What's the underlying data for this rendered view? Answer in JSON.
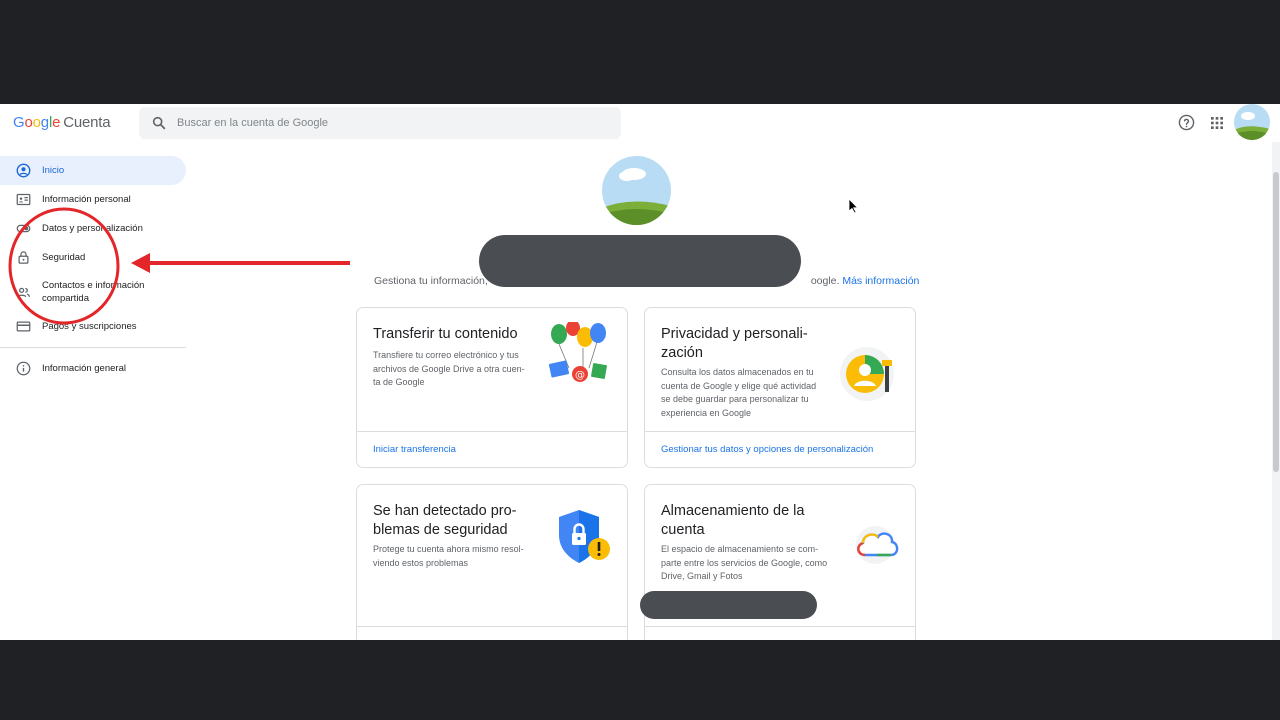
{
  "topbar": {
    "logo_google": [
      "G",
      "o",
      "o",
      "g",
      "l",
      "e"
    ],
    "logo_product": "Cuenta",
    "search_placeholder": "Buscar en la cuenta de Google"
  },
  "sidebar": {
    "items": [
      {
        "label": "Inicio",
        "active": true
      },
      {
        "label": "Información personal"
      },
      {
        "label": "Datos y personalización"
      },
      {
        "label": "Seguridad"
      },
      {
        "label": "Contactos e información compartida"
      },
      {
        "label": "Pagos y suscripciones"
      },
      {
        "label": "Información general"
      }
    ]
  },
  "main": {
    "subtitle_start": "Gestiona tu información,",
    "subtitle_end": "oogle.",
    "subtitle_link": "Más información",
    "cards": [
      {
        "title_1": "Transferir tu contenido",
        "desc": [
          "Transfiere tu correo electrónico y tus",
          "archivos de Google Drive a otra cuen-",
          "ta de Google"
        ],
        "link": "Iniciar transferencia"
      },
      {
        "title_1": "Privacidad y personali-",
        "title_2": "zación",
        "desc": [
          "Consulta los datos almacenados en tu",
          "cuenta de Google y elige qué actividad",
          "se debe guardar para personalizar tu",
          "experiencia en Google"
        ],
        "link": "Gestionar tus datos y opciones de personalización"
      },
      {
        "title_1": "Se han detectado pro-",
        "title_2": "blemas de seguridad",
        "desc": [
          "Protege tu cuenta ahora mismo resol-",
          "viendo estos problemas"
        ]
      },
      {
        "title_1": "Almacenamiento de la",
        "title_2": "cuenta",
        "desc": [
          "El espacio de almacenamiento se com-",
          "parte entre los servicios de Google, como",
          "Drive, Gmail y Fotos"
        ]
      }
    ]
  },
  "colors": {
    "accent_blue": "#1a73e8",
    "active_bg": "#e8f0fe",
    "annotation_red": "#e3262a",
    "redaction": "#4a4d52",
    "frame_dark": "#202124"
  }
}
